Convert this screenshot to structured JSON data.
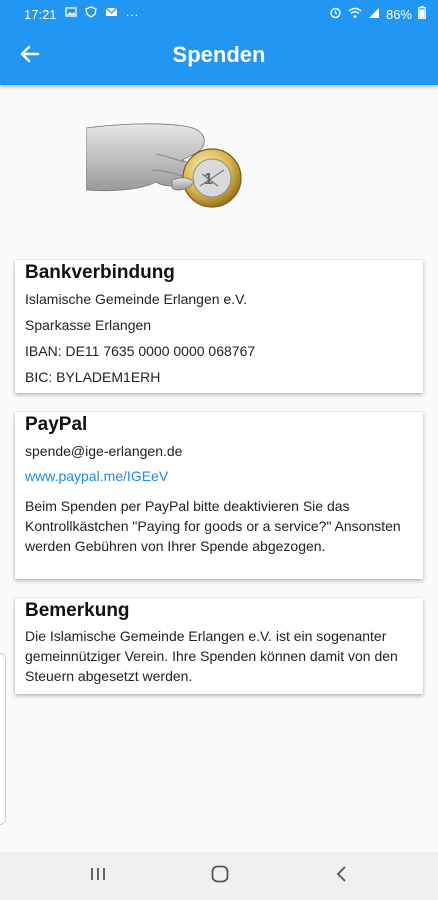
{
  "status_bar": {
    "time": "17:21",
    "more_indicator": "···",
    "battery": "86%",
    "icons": [
      "image-icon",
      "shield-icon",
      "mail-icon",
      "alarm-icon",
      "wifi-icon",
      "signal-icon",
      "battery-icon"
    ]
  },
  "app_bar": {
    "title": "Spenden",
    "back_icon": "arrow-left-icon",
    "color": "#2196f3"
  },
  "hero_image": "hand-holding-euro-coin",
  "bank": {
    "title": "Bankverbindung",
    "lines": [
      "Islamische Gemeinde Erlangen e.V.",
      "Sparkasse Erlangen",
      "IBAN: DE11 7635 0000 0000 068767",
      "BIC: BYLADEM1ERH"
    ]
  },
  "paypal": {
    "title": "PayPal",
    "email": "spende@ige-erlangen.de",
    "link": "www.paypal.me/IGEeV",
    "note": "Beim Spenden per PayPal bitte deaktivieren Sie das Kontrollkästchen \"Paying for goods or a service?\" Ansonsten werden Gebühren von Ihrer Spende abgezogen."
  },
  "remark": {
    "title": "Bemerkung",
    "text": "Die Islamische Gemeinde Erlangen e.V. ist ein sogenanter gemeinnütziger Verein. Ihre Spenden können damit von den Steuern abgesetzt werden."
  },
  "nav_bar": {
    "icons": [
      "recent-apps-icon",
      "home-icon",
      "back-icon"
    ]
  },
  "colors": {
    "accent": "#2196f3",
    "link": "#1e88e5"
  }
}
